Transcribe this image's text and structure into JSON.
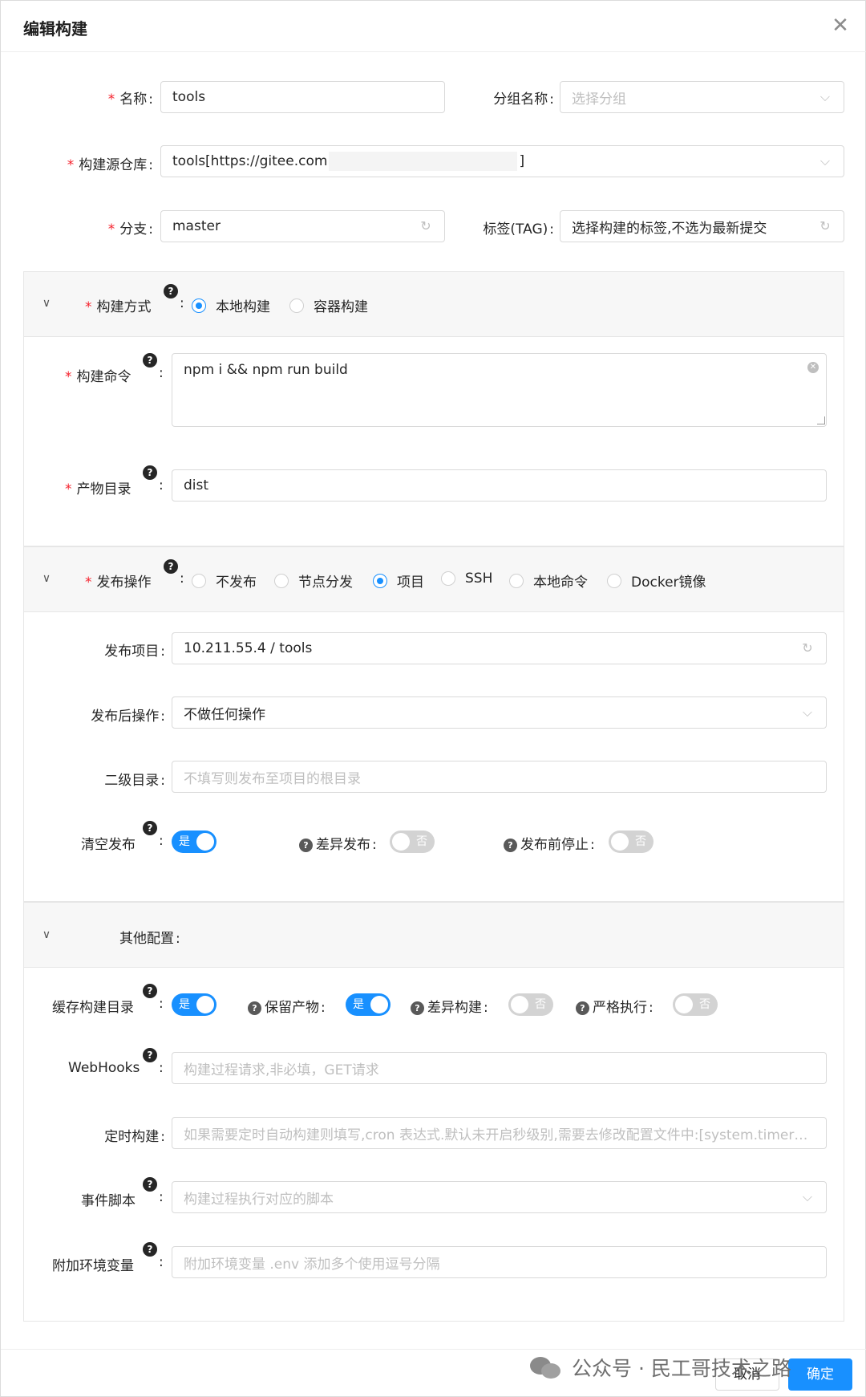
{
  "dialog": {
    "title": "编辑构建"
  },
  "basic": {
    "name_label": "名称",
    "name_value": "tools",
    "group_label": "分组名称",
    "group_placeholder": "选择分组",
    "repo_label": "构建源仓库",
    "repo_value": "tools[https://gitee.com",
    "repo_value_end": "]",
    "branch_label": "分支",
    "branch_value": "master",
    "tag_label": "标签(TAG)",
    "tag_placeholder": "选择构建的标签,不选为最新提交"
  },
  "build": {
    "mode_label": "构建方式",
    "mode_options": [
      "本地构建",
      "容器构建"
    ],
    "mode_selected": 0,
    "command_label": "构建命令",
    "command_value": "npm i && npm run build",
    "artifact_label": "产物目录",
    "artifact_value": "dist"
  },
  "publish": {
    "op_label": "发布操作",
    "op_options": [
      "不发布",
      "节点分发",
      "项目",
      "SSH",
      "本地命令",
      "Docker镜像"
    ],
    "op_selected": 2,
    "project_label": "发布项目",
    "project_value": "10.211.55.4 / tools",
    "after_label": "发布后操作",
    "after_value": "不做任何操作",
    "subdir_label": "二级目录",
    "subdir_placeholder": "不填写则发布至项目的根目录",
    "clear_label": "清空发布",
    "clear_on": true,
    "diff_label": "差异发布",
    "diff_on": false,
    "stop_label": "发布前停止",
    "stop_on": false,
    "switch_yes": "是",
    "switch_no": "否"
  },
  "other": {
    "section_label": "其他配置",
    "cache_label": "缓存构建目录",
    "cache_on": true,
    "keep_label": "保留产物",
    "keep_on": true,
    "diffbuild_label": "差异构建",
    "diffbuild_on": false,
    "strict_label": "严格执行",
    "strict_on": false,
    "webhooks_label": "WebHooks",
    "webhooks_placeholder": "构建过程请求,非必填，GET请求",
    "cron_label": "定时构建",
    "cron_placeholder": "如果需要定时自动构建则填写,cron 表达式.默认未开启秒级别,需要去修改配置文件中:[system.timerMatchSecond]",
    "script_label": "事件脚本",
    "script_placeholder": "构建过程执行对应的脚本",
    "env_label": "附加环境变量",
    "env_placeholder": "附加环境变量  .env 添加多个使用逗号分隔"
  },
  "footer": {
    "cancel": "取消",
    "ok": "确定"
  },
  "watermark": {
    "text": "公众号 · 民工哥技术之路"
  },
  "colors": {
    "primary": "#1890ff",
    "required": "#f5222d",
    "placeholder": "#bfbfbf"
  }
}
